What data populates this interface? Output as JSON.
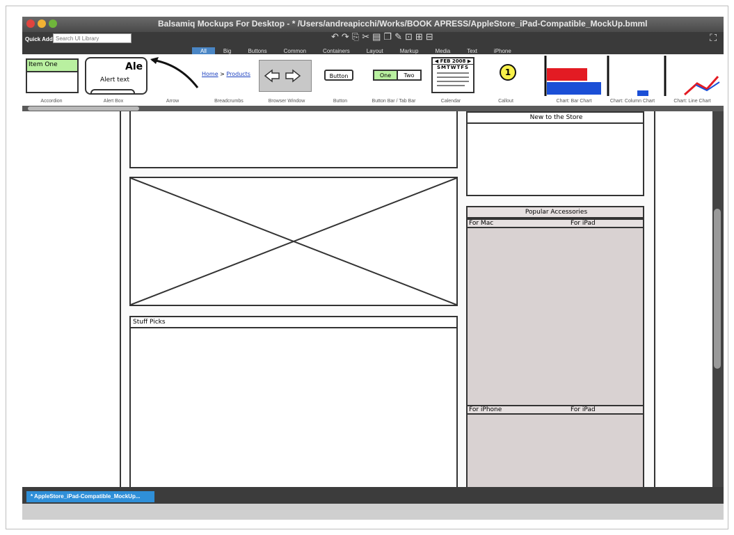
{
  "window": {
    "title": "Balsamiq Mockups For Desktop - * /Users/andreapicchi/Works/BOOK APRESS/AppleStore_iPad-Compatible_MockUp.bmml"
  },
  "quick_add": {
    "label": "Quick Add:",
    "placeholder": "Search UI Library"
  },
  "toolbar_icons": [
    "undo-icon",
    "redo-icon",
    "copy-icon",
    "cut-icon",
    "paste-icon",
    "duplicate-icon",
    "edit-icon",
    "group-icon",
    "ungroup-icon",
    "lock-icon"
  ],
  "tabs": [
    {
      "label": "All",
      "active": true
    },
    {
      "label": "Big"
    },
    {
      "label": "Buttons"
    },
    {
      "label": "Common"
    },
    {
      "label": "Containers"
    },
    {
      "label": "Layout"
    },
    {
      "label": "Markup"
    },
    {
      "label": "Media"
    },
    {
      "label": "Text"
    },
    {
      "label": "iPhone"
    }
  ],
  "library": {
    "accordion": {
      "caption": "Accordion",
      "item": "Item One"
    },
    "alert": {
      "caption": "Alert Box",
      "title": "Ale",
      "text": "Alert text"
    },
    "arrow": {
      "caption": "Arrow"
    },
    "breadcrumbs": {
      "caption": "Breadcrumbs",
      "home": "Home",
      "sep": ">",
      "current": "Products"
    },
    "browser": {
      "caption": "Browser Window"
    },
    "button": {
      "caption": "Button",
      "label": "Button"
    },
    "buttonbar": {
      "caption": "Button Bar / Tab Bar",
      "one": "One",
      "two": "Two"
    },
    "calendar": {
      "caption": "Calendar",
      "month": "◀ FEB 2008 ▶",
      "days": "SMTWTFS"
    },
    "callout": {
      "caption": "Callout",
      "number": "1"
    },
    "barchart": {
      "caption": "Chart: Bar Chart"
    },
    "columnchart": {
      "caption": "Chart: Column Chart"
    },
    "linechart": {
      "caption": "Chart: Line Chart"
    }
  },
  "mockup": {
    "new_store": {
      "title": "New to the Store"
    },
    "popular": {
      "title": "Popular Accessories",
      "for_mac": "For Mac",
      "for_ipad": "For iPad",
      "for_iphone": "For iPhone",
      "for_ipad_2": "For iPad"
    },
    "stuff_picks": {
      "title": "Stuff Picks"
    }
  },
  "document_tab": {
    "label": "* AppleStore_iPad-Compatible_MockUp..."
  },
  "colors": {
    "accent": "#2f8fd8",
    "tab_active": "#4a86c5",
    "grey_panel": "#d9d2d2"
  }
}
